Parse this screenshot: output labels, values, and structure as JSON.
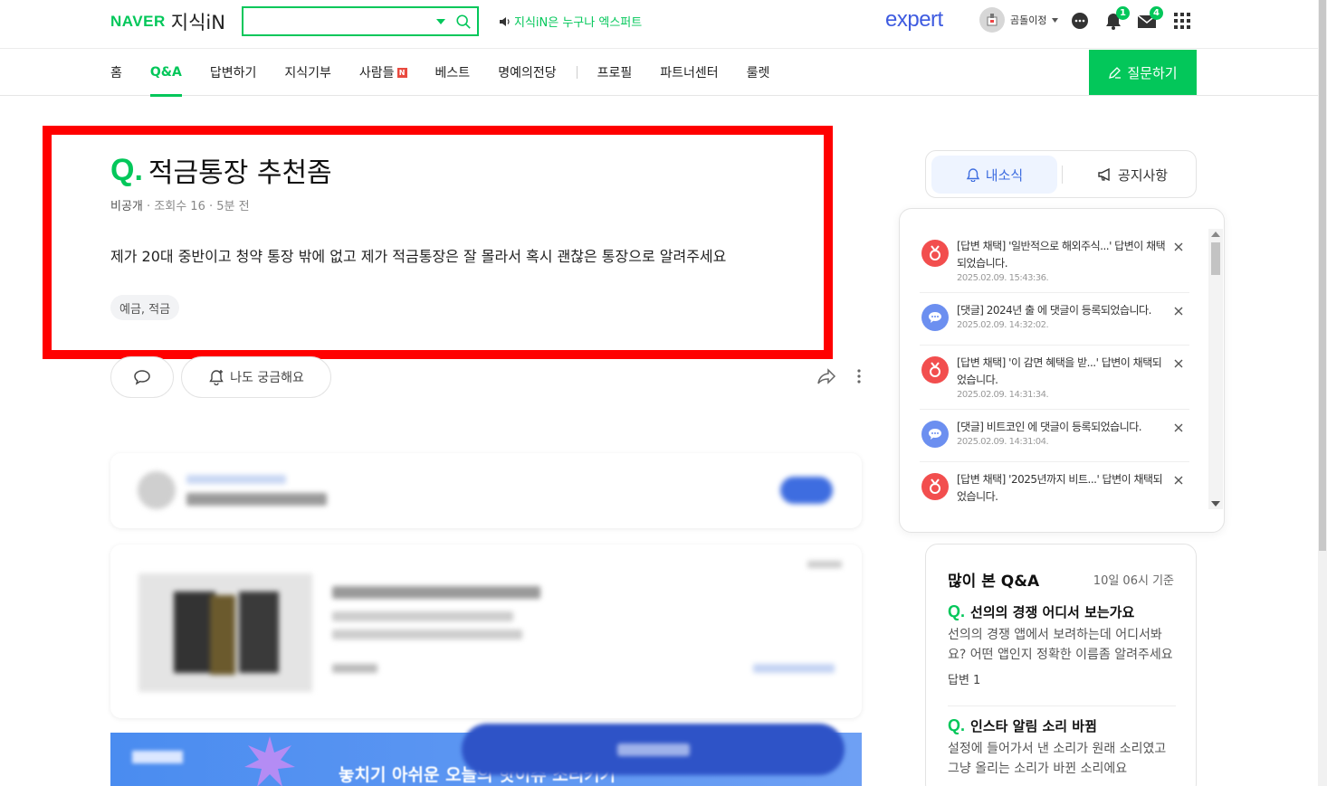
{
  "header": {
    "brand": "NAVER",
    "service": "지식iN",
    "search_placeholder": "",
    "top_notice": "지식iN은 누구나 엑스퍼트",
    "expert_logo": "expert",
    "username": "곰돌이정",
    "bell_count": "1",
    "mail_count": "4"
  },
  "nav": {
    "items": [
      "홈",
      "Q&A",
      "답변하기",
      "지식기부",
      "사람들",
      "베스트",
      "명예의전당",
      "프로필",
      "파트너센터",
      "룰렛"
    ],
    "new_badge": "N",
    "ask_button": "질문하기"
  },
  "question": {
    "mark": "Q.",
    "title": "적금통장 추천좀",
    "meta_private": "비공개",
    "meta_views": "조회수 16",
    "meta_time": "5분 전",
    "body": "제가 20대 중반이고 청약 통장 밖에 없고 제가 적금통장은 잘 몰라서 혹시 괜찮은 통장으로 알려주세요",
    "tag": "예금, 적금",
    "curious_button": "나도 궁금해요"
  },
  "banner": {
    "text": "놓치기 아쉬운 오늘의 핫이슈 소리키기"
  },
  "right": {
    "tab_news": "내소식",
    "tab_notice": "공지사항",
    "notifications": [
      {
        "type": "red",
        "text": "[답변 채택] '일반적으로 해외주식...' 답변이 채택되었습니다.",
        "time": "2025.02.09. 15:43:36."
      },
      {
        "type": "blue",
        "text": "[댓글] 2024년 출 에 댓글이 등록되었습니다.",
        "time": "2025.02.09. 14:32:02."
      },
      {
        "type": "red",
        "text": "[답변 채택] '이 감면 혜택을 받...' 답변이 채택되었습니다.",
        "time": "2025.02.09. 14:31:34."
      },
      {
        "type": "blue",
        "text": "[댓글] 비트코인 에 댓글이 등록되었습니다.",
        "time": "2025.02.09. 14:31:04."
      },
      {
        "type": "red",
        "text": "[답변 채택] '2025년까지 비트...' 답변이 채택되었습니다.",
        "time": ""
      }
    ],
    "popular": {
      "title": "많이 본 Q&A",
      "time": "10일 06시 기준",
      "items": [
        {
          "q": "Q.",
          "title": "선의의 경쟁 어디서 보는가요",
          "desc": "선의의 경쟁 앱에서 보려하는데 어디서봐요? 어떤 앱인지 정확한 이름좀 알려주세요",
          "answers": "답변 1"
        },
        {
          "q": "Q.",
          "title": "인스타 알림 소리 바뀜",
          "desc": "설정에 들어가서 낸 소리가 원래 소리였고 그냥 올리는 소리가 바뀐 소리에요",
          "answers": ""
        }
      ]
    }
  }
}
